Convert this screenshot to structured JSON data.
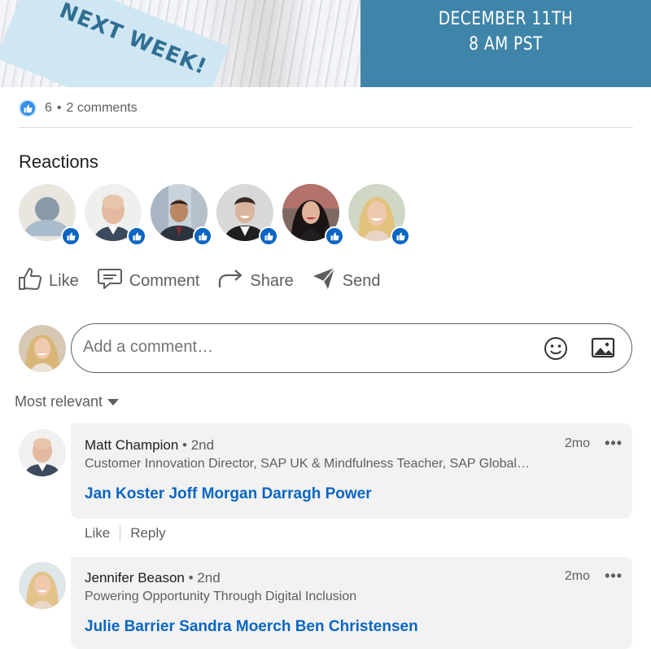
{
  "banner": {
    "ribbon_text": "NEXT WEEK!",
    "date_line1": "DECEMBER 11TH",
    "date_line2": "8 AM PST",
    "blue_color": "#3f84a9"
  },
  "social": {
    "reaction_count": "6",
    "dot": "•",
    "comments": "2 comments"
  },
  "reactions": {
    "title": "Reactions",
    "people": [
      {
        "name": "placeholder-avatar"
      },
      {
        "name": "bald-man-avatar"
      },
      {
        "name": "man-in-suit-avatar"
      },
      {
        "name": "smiling-man-avatar"
      },
      {
        "name": "dark-haired-woman-avatar"
      },
      {
        "name": "blonde-woman-avatar"
      }
    ]
  },
  "actions": {
    "like": "Like",
    "comment": "Comment",
    "share": "Share",
    "send": "Send"
  },
  "composer": {
    "placeholder": "Add a comment…"
  },
  "sort": {
    "label": "Most relevant"
  },
  "comments": [
    {
      "name": "Matt Champion",
      "degree": "• 2nd",
      "headline": "Customer Innovation Director, SAP UK & Mindfulness Teacher, SAP Global…",
      "mentions": "Jan Koster Joff Morgan Darragh Power",
      "time": "2mo",
      "more": "•••",
      "like": "Like",
      "reply": "Reply"
    },
    {
      "name": "Jennifer Beason",
      "degree": "• 2nd",
      "headline": "Powering Opportunity Through Digital Inclusion",
      "mentions": "Julie Barrier Sandra Moerch Ben Christensen",
      "time": "2mo",
      "more": "•••"
    }
  ],
  "colors": {
    "link_blue": "#0a66c2",
    "text_gray": "#5e5e5e",
    "bubble_bg": "#f2f2f2"
  }
}
